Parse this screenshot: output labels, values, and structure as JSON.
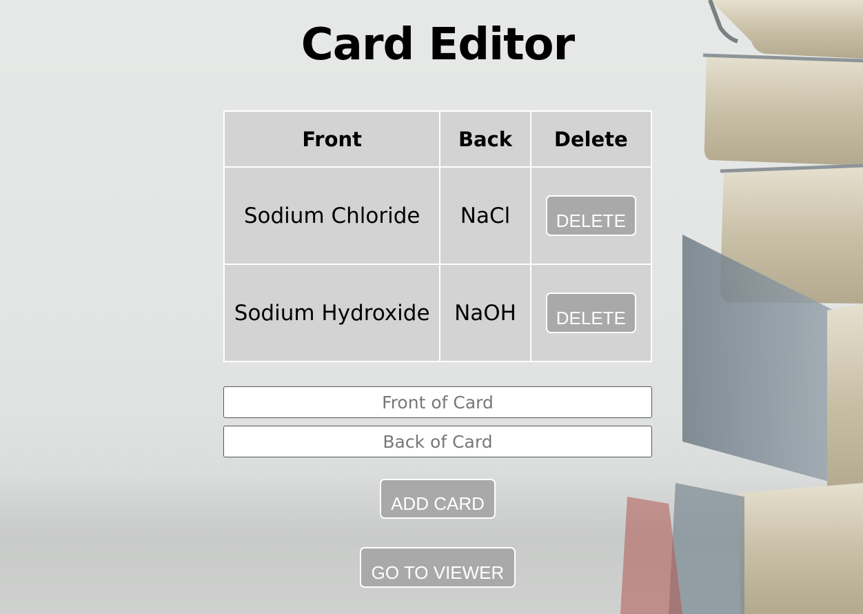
{
  "page": {
    "title": "Card Editor"
  },
  "table": {
    "headers": [
      "Front",
      "Back",
      "Delete"
    ],
    "rows": [
      {
        "front": "Sodium Chloride",
        "back": "NaCl",
        "delete_label": "DELETE"
      },
      {
        "front": "Sodium Hydroxide",
        "back": "NaOH",
        "delete_label": "DELETE"
      }
    ]
  },
  "form": {
    "front_placeholder": "Front of Card",
    "front_value": "",
    "back_placeholder": "Back of Card",
    "back_value": "",
    "add_label": "ADD CARD"
  },
  "nav": {
    "viewer_label": "GO TO VIEWER"
  },
  "colors": {
    "table_bg": "#d3d3d3",
    "button_bg": "#a9a9a9",
    "button_text": "#ffffff",
    "border": "#ffffff"
  },
  "background": {
    "image": "stack-of-books-photo"
  }
}
